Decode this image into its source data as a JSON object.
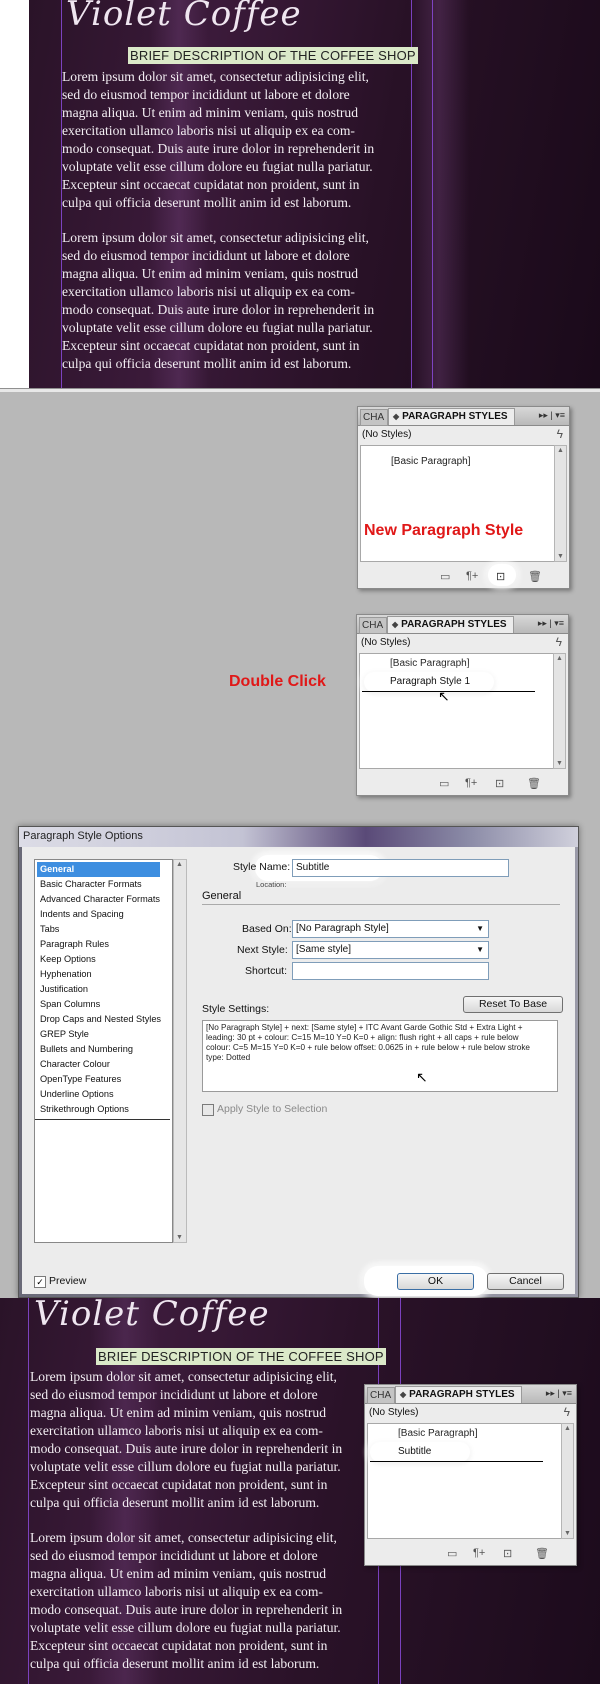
{
  "document": {
    "logo": "Violet Coffee",
    "brief": "BRIEF DESCRIPTION OF THE COFFEE SHOP",
    "paragraph1": [
      "Lorem ipsum dolor sit amet, consectetur adipisicing elit,",
      "sed do eiusmod tempor incididunt ut labore et dolore",
      "magna aliqua. Ut enim ad minim veniam, quis nostrud",
      "exercitation ullamco laboris nisi ut aliquip ex ea com-",
      "modo consequat. Duis aute irure dolor in reprehenderit in",
      "voluptate velit esse cillum dolore eu fugiat nulla pariatur.",
      "Excepteur sint occaecat cupidatat non proident, sunt in",
      "culpa qui officia deserunt mollit anim id est laborum."
    ],
    "paragraph2": [
      "Lorem ipsum dolor sit amet, consectetur adipisicing elit,",
      "sed do eiusmod tempor incididunt ut labore et dolore",
      "magna aliqua. Ut enim ad minim veniam, quis nostrud",
      "exercitation ullamco laboris nisi ut aliquip ex ea com-",
      "modo consequat. Duis aute irure dolor in reprehenderit in",
      "voluptate velit esse cillum dolore eu fugiat nulla pariatur.",
      "Excepteur sint occaecat cupidatat non proident, sunt in",
      "culpa qui officia deserunt mollit anim id est laborum."
    ]
  },
  "panel": {
    "tab_character": "CHA",
    "tab_paragraph_styles": "PARAGRAPH STYLES",
    "no_styles": "(No Styles)",
    "basic_paragraph": "[Basic Paragraph]",
    "new_style_item": "Paragraph Style 1",
    "renamed_item": "Subtitle",
    "menu_glyphs": "▸▸ | ▾≡"
  },
  "annotations": {
    "new_paragraph_style": "New Paragraph Style",
    "double_click": "Double Click"
  },
  "dialog": {
    "title": "Paragraph Style Options",
    "categories": [
      "General",
      "Basic Character Formats",
      "Advanced Character Formats",
      "Indents and Spacing",
      "Tabs",
      "Paragraph Rules",
      "Keep Options",
      "Hyphenation",
      "Justification",
      "Span Columns",
      "Drop Caps and Nested Styles",
      "GREP Style",
      "Bullets and Numbering",
      "Character Colour",
      "OpenType Features",
      "Underline Options",
      "Strikethrough Options"
    ],
    "style_name_label": "Style Name:",
    "style_name_value": "Subtitle",
    "location_label": "Location:",
    "section_general": "General",
    "based_on_label": "Based On:",
    "based_on_value": "[No Paragraph Style]",
    "next_style_label": "Next Style:",
    "next_style_value": "[Same style]",
    "shortcut_label": "Shortcut:",
    "shortcut_value": "",
    "style_settings_label": "Style Settings:",
    "reset_to_base": "Reset To Base",
    "style_settings_text": "[No Paragraph Style] + next: [Same style] + ITC Avant Garde Gothic Std + Extra Light + leading: 30 pt + colour: C=15 M=10 Y=0 K=0 + align: flush right + all caps + rule below colour: C=5 M=15 Y=0 K=0 + rule below offset: 0.0625 in + rule below + rule below stroke type: Dotted",
    "apply_style_label": "Apply Style to Selection",
    "preview_label": "Preview",
    "ok_label": "OK",
    "cancel_label": "Cancel"
  },
  "colors": {
    "annotation_red": "#e01818",
    "selection_blue": "#3d8ee0",
    "brief_highlight": "#dbe9c9"
  }
}
